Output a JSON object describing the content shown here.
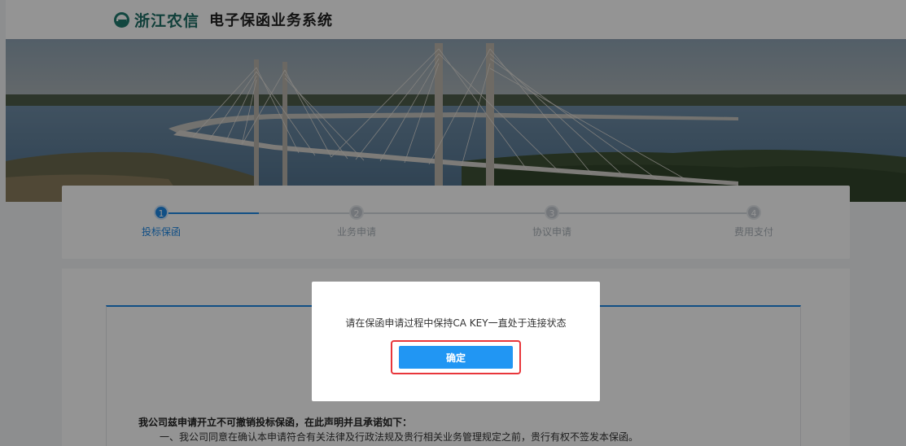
{
  "header": {
    "logo_text": "浙江农信",
    "system_title": "电子保函业务系统"
  },
  "steps": [
    {
      "number": "1",
      "label": "投标保函",
      "active": true
    },
    {
      "number": "2",
      "label": "业务申请",
      "active": false
    },
    {
      "number": "3",
      "label": "协议申请",
      "active": false
    },
    {
      "number": "4",
      "label": "费用支付",
      "active": false
    }
  ],
  "declaration": {
    "title": "我公司兹申请开立不可撤销投标保函，在此声明并且承诺如下：",
    "items": [
      "一、我公司同意在确认本申请符合有关法律及行政法规及贵行相关业务管理规定之前，贵行有权不签发本保函。"
    ]
  },
  "modal": {
    "message": "请在保函申请过程中保持CA KEY一直处于连接状态",
    "confirm_label": "确定"
  },
  "colors": {
    "accent": "#1e88e5",
    "button": "#2196f3",
    "highlight": "#e8363b",
    "brand": "#1d6d64"
  }
}
